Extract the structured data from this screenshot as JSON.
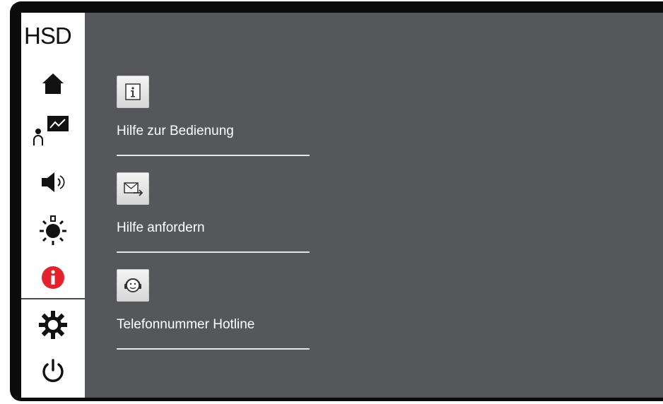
{
  "sidebar": {
    "logo": "HSD",
    "items": [
      {
        "icon": "home-icon",
        "active": false
      },
      {
        "icon": "person-chart-icon",
        "active": false
      },
      {
        "icon": "speaker-icon",
        "active": false
      },
      {
        "icon": "brightness-icon",
        "active": false
      },
      {
        "icon": "info-icon",
        "active": true,
        "color": "#e3222b"
      },
      {
        "icon": "settings-gear-icon",
        "active": false
      },
      {
        "icon": "power-icon",
        "active": false
      }
    ]
  },
  "menu": {
    "items": [
      {
        "icon": "info-document-icon",
        "label": "Hilfe zur Bedienung"
      },
      {
        "icon": "envelope-send-icon",
        "label": "Hilfe anfordern"
      },
      {
        "icon": "headset-support-icon",
        "label": "Telefonnummer Hotline"
      }
    ]
  },
  "colors": {
    "background": "#55575a",
    "sidebar": "#ffffff",
    "accent": "#e3222b",
    "text": "#ffffff"
  }
}
